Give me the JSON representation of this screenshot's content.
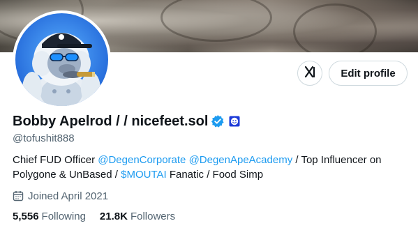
{
  "profile": {
    "display_name": "Bobby Apelrod / / nicefeet.sol",
    "handle": "@tofushit888",
    "verified": true,
    "bio": {
      "part1": "Chief FUD Officer ",
      "mention1": "@DegenCorporate",
      "part2": " ",
      "mention2": "@DegenApeAcademy",
      "part3": " / Top Influencer on Polygone & UnBased / ",
      "cashtag": "$MOUTAI",
      "part4": " Fanatic / Food Simp"
    },
    "joined": "Joined April 2021",
    "following_count": "5,556",
    "following_label": "Following",
    "followers_count": "21.8K",
    "followers_label": "Followers"
  },
  "actions": {
    "grok_icon": "grok-icon",
    "edit_profile_label": "Edit profile"
  },
  "colors": {
    "accent": "#1d9bf0",
    "text_primary": "#0f1419",
    "text_secondary": "#536471",
    "border": "#cfd9de"
  }
}
